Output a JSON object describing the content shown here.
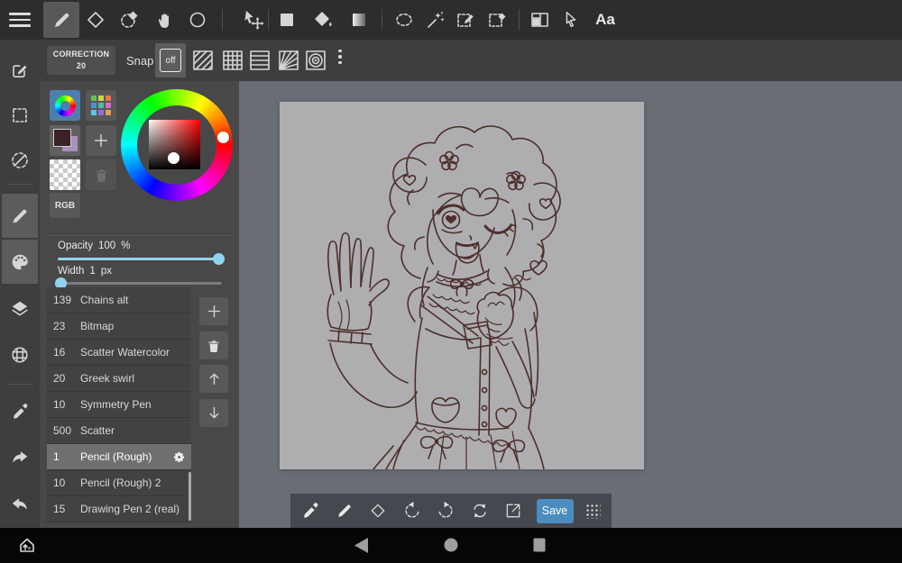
{
  "app": {
    "workspace_bg": "#696d74",
    "canvas_bg": "#aeaeb0",
    "line_color": "#4d2e2c",
    "accent_blue": "#4d7fae",
    "save_blue": "#4a8dbe",
    "slider_color": "#8fd3ef"
  },
  "topbar": {
    "text_tool_label": "Aa"
  },
  "toolbar2": {
    "correction_label": "CORRECTION",
    "correction_value": "20",
    "snap_label": "Snap",
    "snap_off_label": "off"
  },
  "color_panel": {
    "rgb_label": "RGB",
    "current_color": "#3a2226",
    "secondary_color": "#a992bd",
    "sv_hue": "#ff0000",
    "palette_dots": [
      "#6abf4b",
      "#c8d748",
      "#e8734f",
      "#4a90d9",
      "#4bbfa0",
      "#d96ac8",
      "#56c8e8",
      "#9a6ad9",
      "#e8a04f"
    ]
  },
  "sliders": {
    "opacity_label": "Opacity",
    "opacity_value": "100",
    "opacity_unit": "%",
    "width_label": "Width",
    "width_value": "1",
    "width_unit": "px"
  },
  "brushes": {
    "items": [
      {
        "size": "139",
        "name": "Chains alt",
        "selected": false
      },
      {
        "size": "23",
        "name": "Bitmap",
        "selected": false
      },
      {
        "size": "16",
        "name": "Scatter Watercolor",
        "selected": false
      },
      {
        "size": "20",
        "name": "Greek swirl",
        "selected": false
      },
      {
        "size": "10",
        "name": "Symmetry Pen",
        "selected": false
      },
      {
        "size": "500",
        "name": "Scatter",
        "selected": false
      },
      {
        "size": "1",
        "name": "Pencil (Rough)",
        "selected": true
      },
      {
        "size": "10",
        "name": "Pencil (Rough) 2",
        "selected": false
      },
      {
        "size": "15",
        "name": "Drawing Pen 2 (real)",
        "selected": false
      }
    ]
  },
  "bottom_toolbar": {
    "save_label": "Save"
  }
}
